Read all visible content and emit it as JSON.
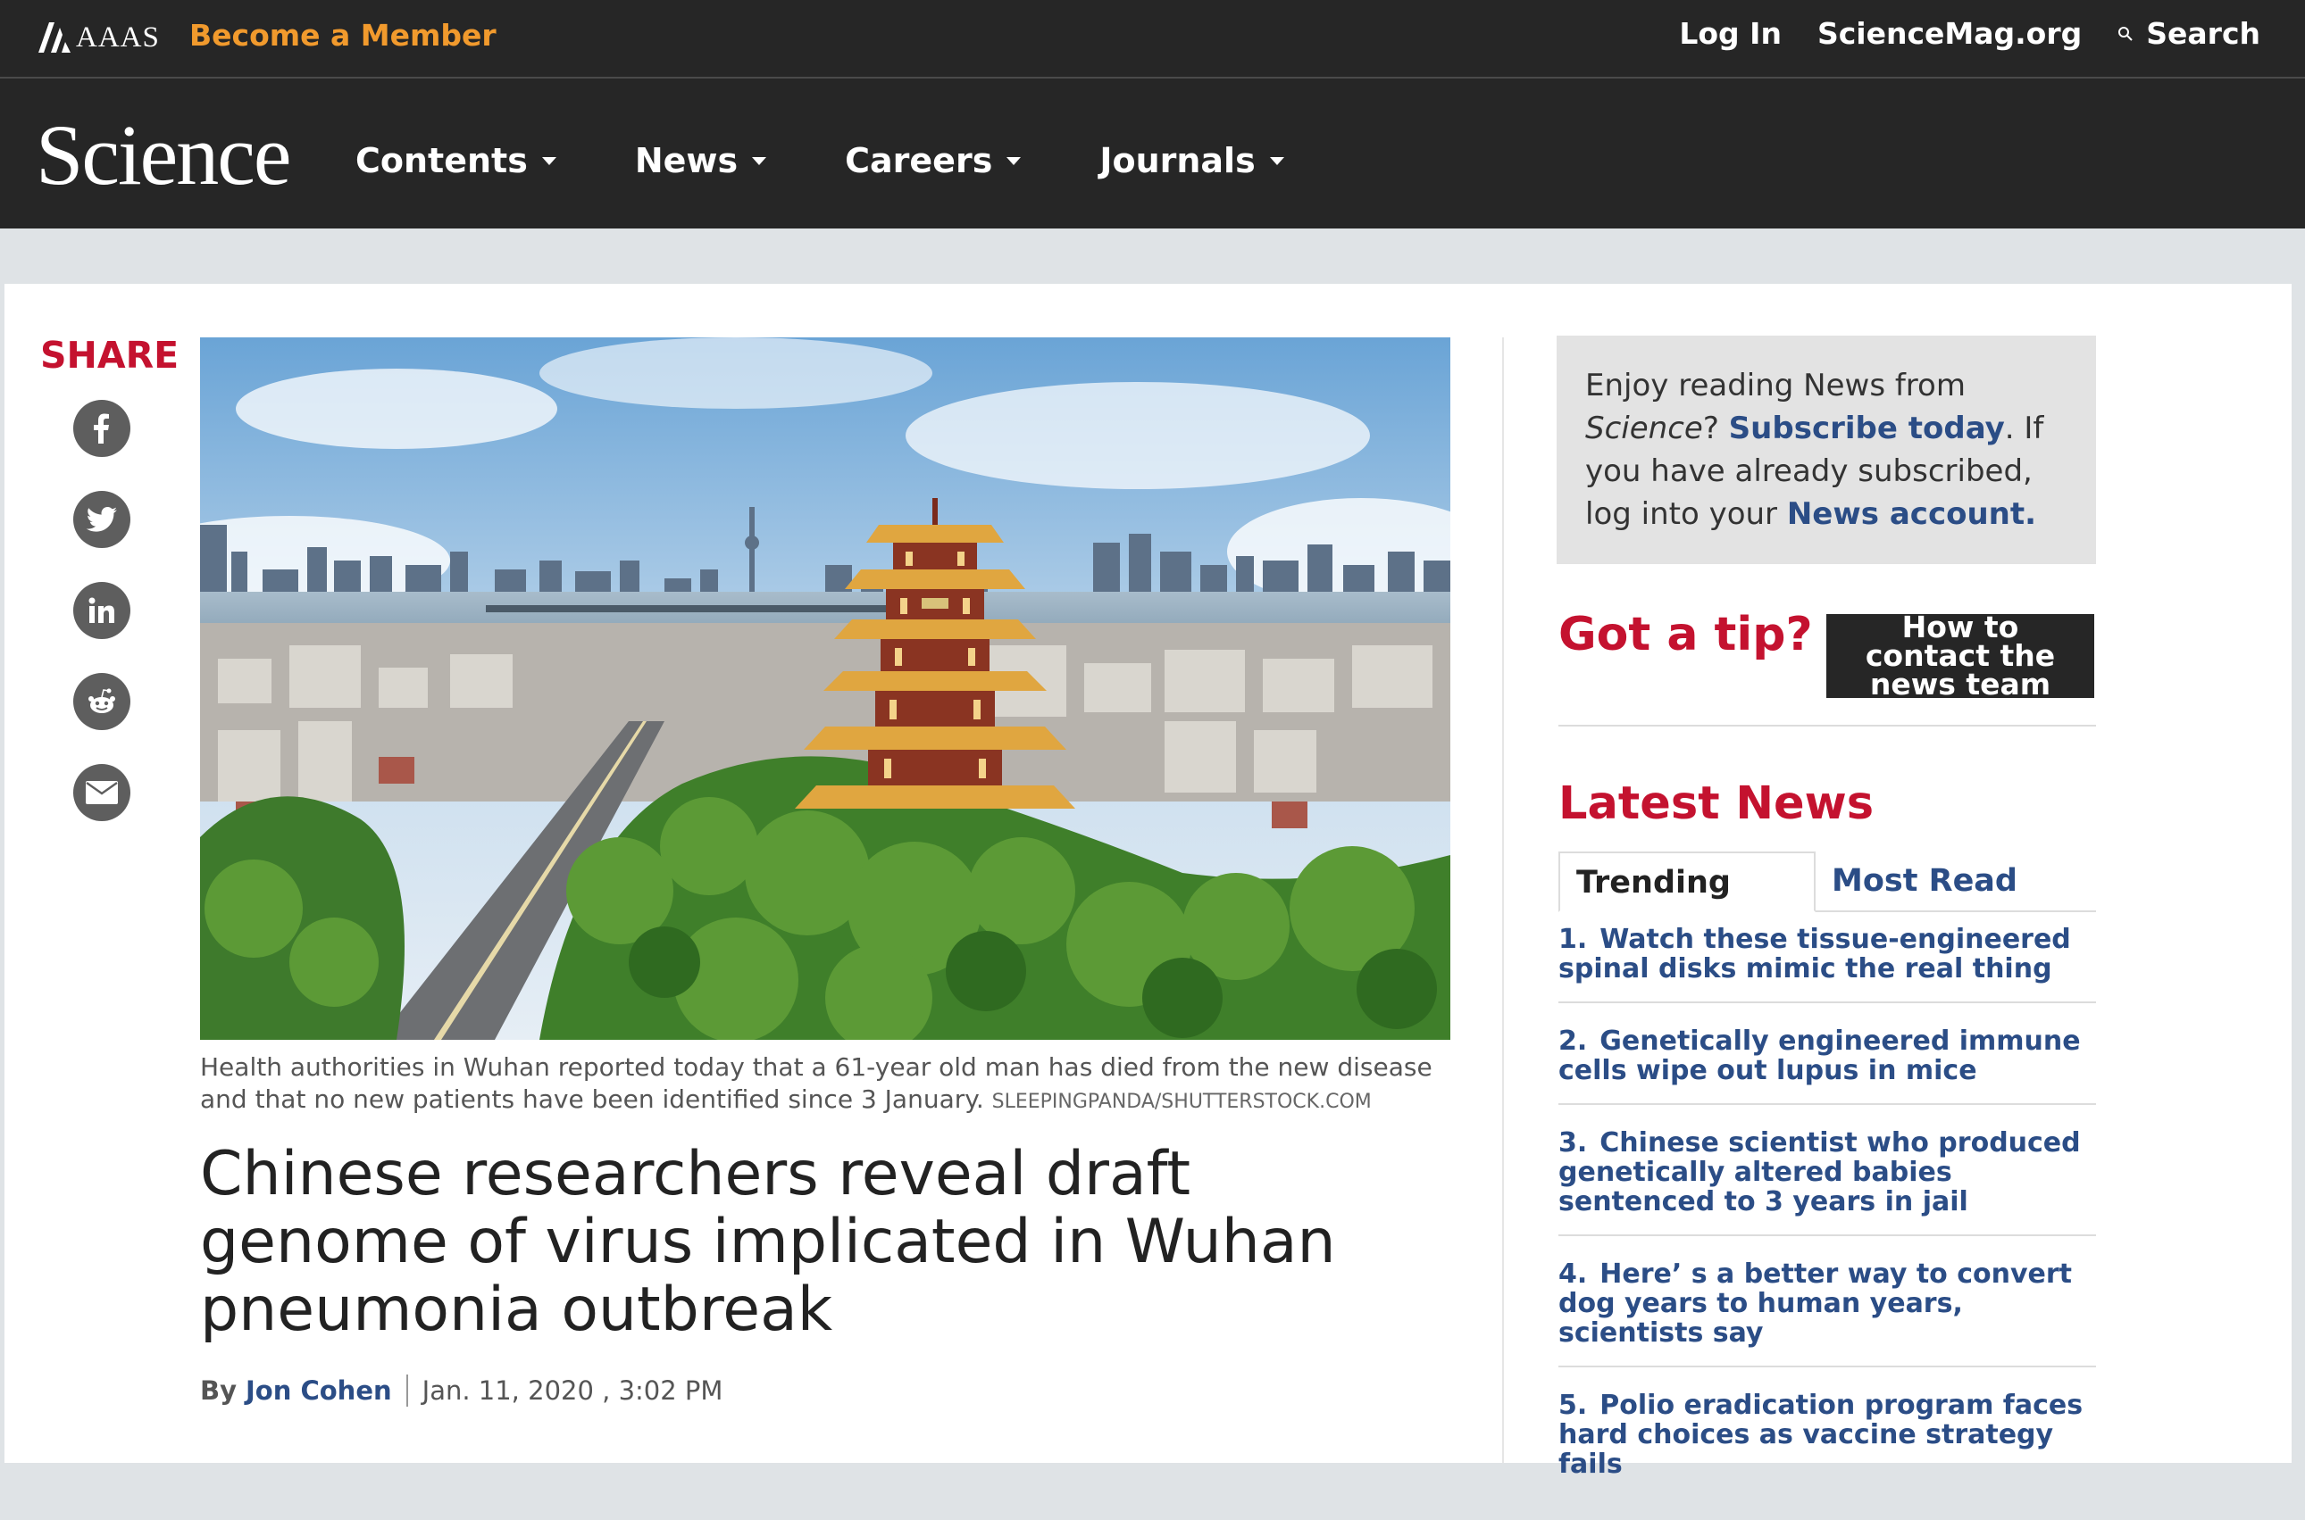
{
  "header": {
    "aaas_logo_text": "AAAS",
    "become_member": "Become a Member",
    "login": "Log In",
    "sciencemag": "ScienceMag.org",
    "search": "Search"
  },
  "nav": {
    "logo": "Science",
    "items": [
      {
        "label": "Contents"
      },
      {
        "label": "News"
      },
      {
        "label": "Careers"
      },
      {
        "label": "Journals"
      }
    ]
  },
  "share": {
    "label": "SHARE",
    "buttons": [
      "facebook-icon",
      "twitter-icon",
      "linkedin-icon",
      "reddit-icon",
      "email-icon"
    ]
  },
  "article": {
    "caption": "Health authorities in Wuhan reported today that a 61-year old man has died from the new disease and that no new patients have been identified since 3 January.",
    "credit": "SLEEPINGPANDA/SHUTTERSTOCK.COM",
    "headline": "Chinese researchers reveal draft genome of virus implicated in Wuhan pneumonia outbreak",
    "by": "By",
    "author": "Jon Cohen",
    "date": "Jan. 11, 2020 , 3:02 PM"
  },
  "sidebar": {
    "subscribe": {
      "text1": "Enjoy reading News from ",
      "science_em": "Science",
      "q": "?",
      "subscribe_link": "Subscribe today",
      "text2": ". If you have already subscribed, log into your ",
      "account_link": "News account."
    },
    "tip": {
      "heading": "Got a tip?",
      "button": "How to contact the news team"
    },
    "latest": {
      "heading": "Latest News",
      "tabs": [
        "Trending",
        "Most Read"
      ],
      "items": [
        {
          "num": "1.",
          "title": "Watch these tissue-engineered spinal disks mimic the real thing"
        },
        {
          "num": "2.",
          "title": "Genetically engineered immune cells wipe out lupus in mice"
        },
        {
          "num": "3.",
          "title": "Chinese scientist who produced genetically altered babies sentenced to 3 years in jail"
        },
        {
          "num": "4.",
          "title": "Here’ s a better way to convert dog years to human years, scientists say"
        },
        {
          "num": "5.",
          "title": "Polio eradication program faces hard choices as vaccine strategy fails"
        }
      ]
    }
  },
  "colors": {
    "brand_red": "#c4122f",
    "link_blue": "#2b4d86",
    "accent_orange": "#f19a2d",
    "header_dark": "#262626"
  }
}
